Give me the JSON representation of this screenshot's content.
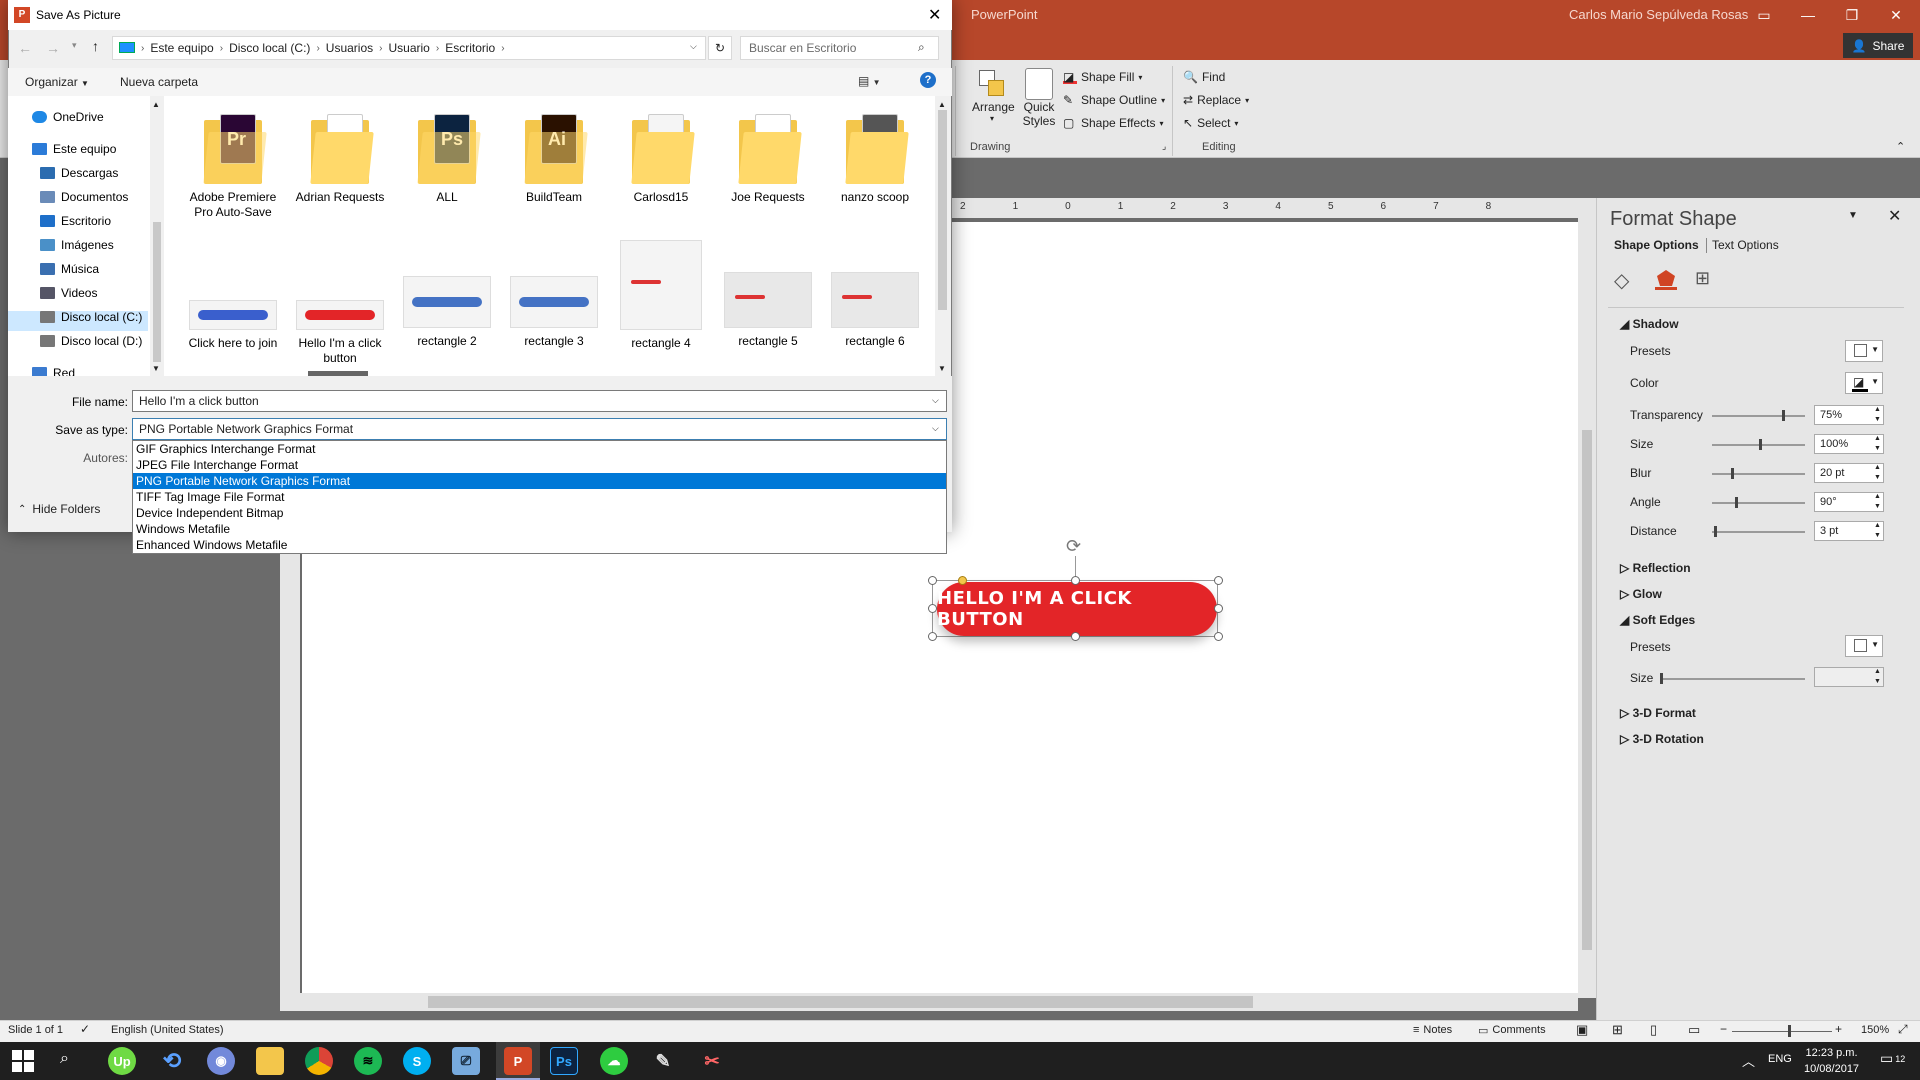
{
  "powerpoint": {
    "app_name": "PowerPoint",
    "user_name": "Carlos Mario Sepúlveda Rosas",
    "share_label": "Share",
    "ribbon": {
      "arrange_label": "Arrange",
      "quick_styles_label": "Quick Styles",
      "shape_fill_label": "Shape Fill",
      "shape_outline_label": "Shape Outline",
      "shape_effects_label": "Shape Effects",
      "drawing_group_label": "Drawing",
      "find_label": "Find",
      "replace_label": "Replace",
      "select_label": "Select",
      "editing_group_label": "Editing"
    },
    "ruler_ticks": [
      "2",
      "1",
      "0",
      "1",
      "2",
      "3",
      "4",
      "5",
      "6",
      "7",
      "8"
    ],
    "slide": {
      "button_text": "HELLO I'M A CLICK BUTTON"
    },
    "status": {
      "slide_info": "Slide 1 of 1",
      "language": "English (United States)",
      "notes": "Notes",
      "comments": "Comments",
      "zoom": "150%"
    }
  },
  "format_pane": {
    "title": "Format Shape",
    "tab_shape_options": "Shape Options",
    "tab_text_options": "Text Options",
    "shadow": {
      "header": "Shadow",
      "presets_label": "Presets",
      "color_label": "Color",
      "transparency_label": "Transparency",
      "transparency_value": "75%",
      "transparency_level": 0.75,
      "size_label": "Size",
      "size_value": "100%",
      "size_level": 0.5,
      "blur_label": "Blur",
      "blur_value": "20 pt",
      "blur_level": 0.2,
      "angle_label": "Angle",
      "angle_value": "90°",
      "angle_level": 0.25,
      "distance_label": "Distance",
      "distance_value": "3 pt",
      "distance_level": 0.02
    },
    "reflection": "Reflection",
    "glow": "Glow",
    "soft_edges": {
      "header": "Soft Edges",
      "presets_label": "Presets",
      "size_label": "Size"
    },
    "format_3d": "3-D Format",
    "rotation_3d": "3-D Rotation"
  },
  "dialog": {
    "title": "Save As Picture",
    "breadcrumb": [
      "Este equipo",
      "Disco local (C:)",
      "Usuarios",
      "Usuario",
      "Escritorio"
    ],
    "search_placeholder": "Buscar en Escritorio",
    "organize_label": "Organizar",
    "new_folder_label": "Nueva carpeta",
    "nav_items": [
      {
        "label": "OneDrive",
        "icon": "cloud-icon"
      },
      {
        "label": "Este equipo",
        "icon": "computer-icon"
      },
      {
        "label": "Descargas",
        "icon": "download-icon"
      },
      {
        "label": "Documentos",
        "icon": "documents-icon"
      },
      {
        "label": "Escritorio",
        "icon": "desktop-icon"
      },
      {
        "label": "Imágenes",
        "icon": "pictures-icon"
      },
      {
        "label": "Música",
        "icon": "music-icon"
      },
      {
        "label": "Videos",
        "icon": "videos-icon"
      },
      {
        "label": "Disco local (C:)",
        "icon": "drive-icon"
      },
      {
        "label": "Disco local (D:)",
        "icon": "drive-icon"
      },
      {
        "label": "Red",
        "icon": "network-icon"
      }
    ],
    "folders": [
      {
        "label": "Adobe Premiere Pro Auto-Save",
        "badge": "Pr",
        "badge_color": "#2a0634"
      },
      {
        "label": "Adrian Requests",
        "badge": "",
        "badge_color": "#ffffff"
      },
      {
        "label": "ALL",
        "badge": "Ps",
        "badge_color": "#0c2340"
      },
      {
        "label": "BuildTeam",
        "badge": "Ai",
        "badge_color": "#2a1100"
      },
      {
        "label": "Carlosd15",
        "badge": "",
        "badge_color": "#f5f5f5"
      },
      {
        "label": "Joe Requests",
        "badge": "",
        "badge_color": "#ffffff"
      },
      {
        "label": "nanzo scoop",
        "badge": "",
        "badge_color": "#555555"
      }
    ],
    "files": [
      {
        "label": "Click here to join",
        "thumb_color": "#3a5fcd"
      },
      {
        "label": "Hello I'm a click button",
        "thumb_color": "#e32528"
      },
      {
        "label": "rectangle 2",
        "thumb_color": "#4472c4"
      },
      {
        "label": "rectangle 3",
        "thumb_color": "#4472c4"
      },
      {
        "label": "rectangle 4",
        "thumb_color": "#d33"
      },
      {
        "label": "rectangle 5",
        "thumb_color": "#d33"
      },
      {
        "label": "rectangle 6",
        "thumb_color": "#d33"
      }
    ],
    "file_name_label": "File name:",
    "file_name_value": "Hello I'm a click button",
    "save_type_label": "Save as type:",
    "save_type_value": "PNG Portable Network Graphics Format",
    "authors_label": "Autores:",
    "type_options": [
      "GIF Graphics Interchange Format",
      "JPEG File Interchange Format",
      "PNG Portable Network Graphics Format",
      "TIFF Tag Image File Format",
      "Device Independent Bitmap",
      "Windows Metafile",
      "Enhanced Windows Metafile"
    ],
    "selected_type_index": 2,
    "hide_folders_label": "Hide Folders"
  },
  "taskbar": {
    "language": "ENG",
    "time": "12:23 p.m.",
    "date": "10/08/2017",
    "notifications": "12"
  }
}
